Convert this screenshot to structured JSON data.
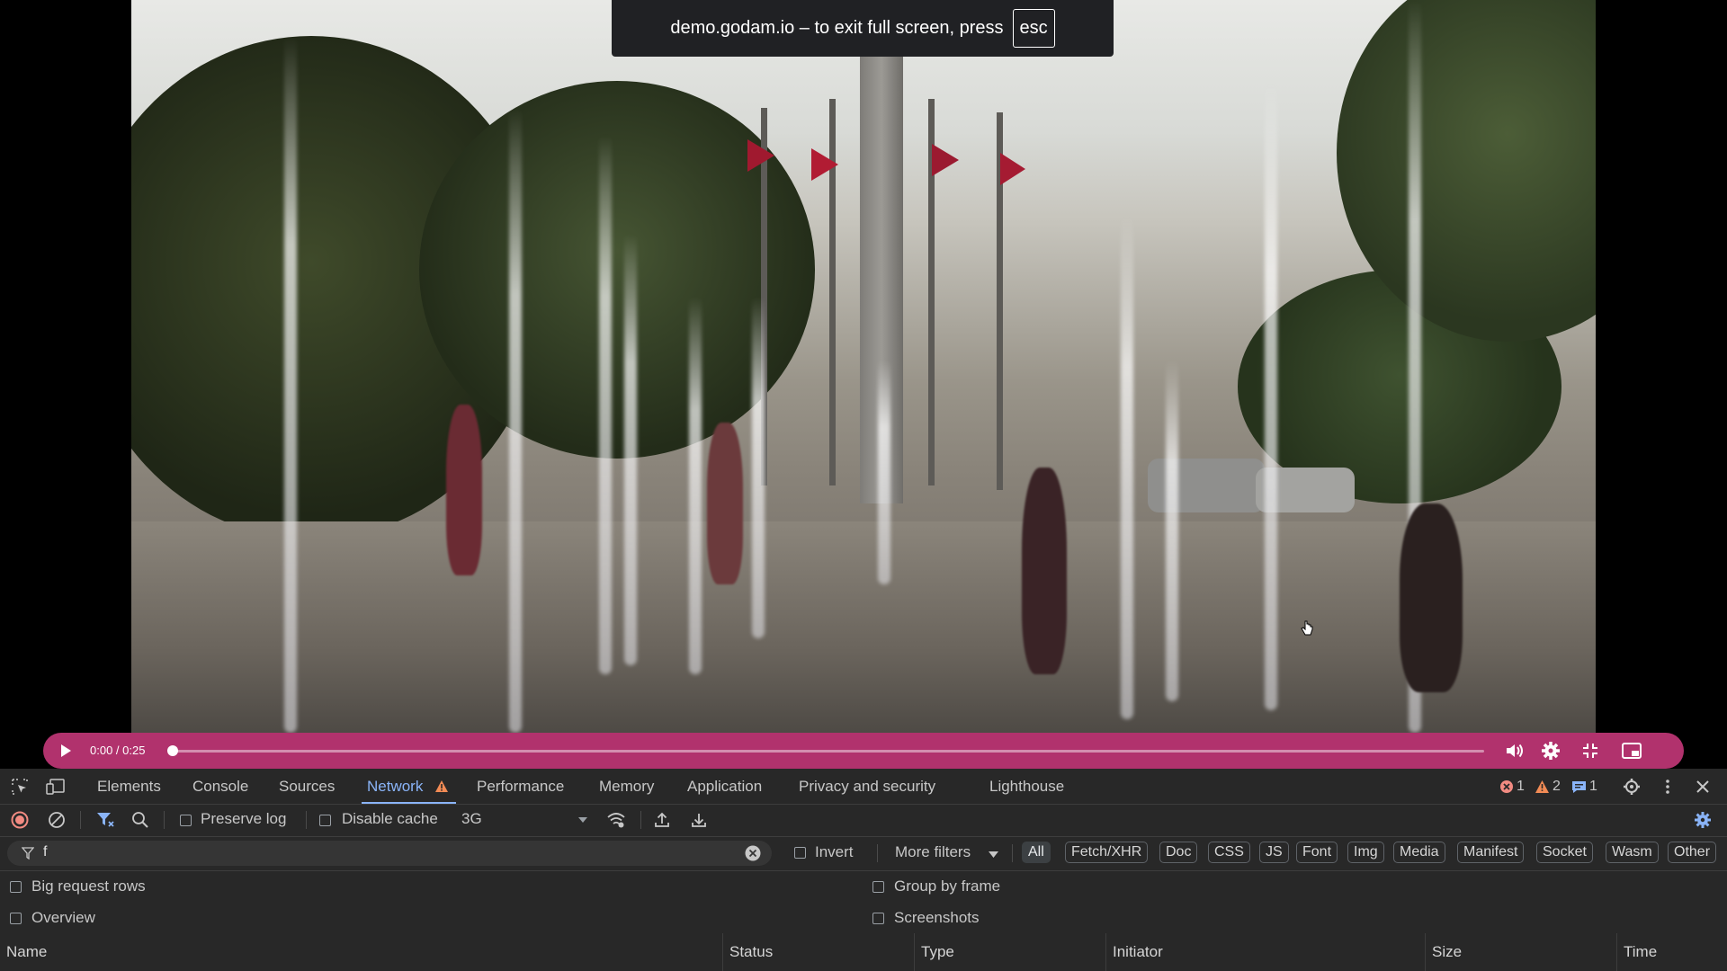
{
  "fullscreen_notice": {
    "text": "demo.godam.io – to exit full screen, press",
    "key": "esc"
  },
  "player": {
    "time": "0:00 / 0:25",
    "progress_fraction": 0.0,
    "controls": [
      "play-icon",
      "volume-icon",
      "settings-icon",
      "exit-fullscreen-icon",
      "picture-in-picture-icon"
    ],
    "accent": "#b1326d"
  },
  "devtools": {
    "tabs": [
      "Elements",
      "Console",
      "Sources",
      "Network",
      "Performance",
      "Memory",
      "Application",
      "Privacy and security",
      "Lighthouse"
    ],
    "active_tab": "Network",
    "counters": {
      "errors": "1",
      "warnings": "2",
      "messages": "1"
    },
    "toolbar": {
      "preserve_log": "Preserve log",
      "disable_cache": "Disable cache",
      "throttling": "3G"
    },
    "filter": {
      "value": "f",
      "invert": "Invert",
      "more_filters": "More filters",
      "types": [
        "All",
        "Fetch/XHR",
        "Doc",
        "CSS",
        "JS",
        "Font",
        "Img",
        "Media",
        "Manifest",
        "Socket",
        "Wasm",
        "Other"
      ]
    },
    "options": {
      "big_request_rows": "Big request rows",
      "overview": "Overview",
      "group_by_frame": "Group by frame",
      "screenshots": "Screenshots"
    },
    "columns": [
      "Name",
      "Status",
      "Type",
      "Initiator",
      "Size",
      "Time"
    ]
  }
}
